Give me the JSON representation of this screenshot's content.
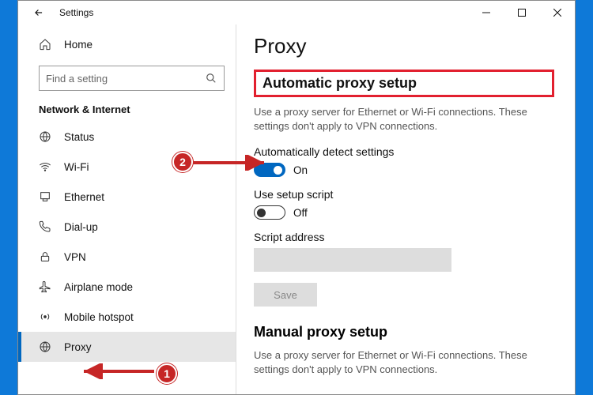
{
  "window": {
    "title": "Settings"
  },
  "sidebar": {
    "home": "Home",
    "search_placeholder": "Find a setting",
    "category": "Network & Internet",
    "items": [
      {
        "label": "Status",
        "icon": "status"
      },
      {
        "label": "Wi-Fi",
        "icon": "wifi"
      },
      {
        "label": "Ethernet",
        "icon": "ethernet"
      },
      {
        "label": "Dial-up",
        "icon": "dialup"
      },
      {
        "label": "VPN",
        "icon": "vpn"
      },
      {
        "label": "Airplane mode",
        "icon": "airplane"
      },
      {
        "label": "Mobile hotspot",
        "icon": "hotspot"
      },
      {
        "label": "Proxy",
        "icon": "proxy"
      }
    ]
  },
  "content": {
    "page_title": "Proxy",
    "auto": {
      "section_title": "Automatic proxy setup",
      "description": "Use a proxy server for Ethernet or Wi-Fi connections. These settings don't apply to VPN connections.",
      "detect_label": "Automatically detect settings",
      "detect_state": "On",
      "script_label": "Use setup script",
      "script_state": "Off",
      "script_addr_label": "Script address",
      "script_addr_value": "",
      "save_label": "Save"
    },
    "manual": {
      "section_title": "Manual proxy setup",
      "description": "Use a proxy server for Ethernet or Wi-Fi connections. These settings don't apply to VPN connections."
    }
  },
  "annotations": {
    "marker1": "1",
    "marker2": "2"
  }
}
